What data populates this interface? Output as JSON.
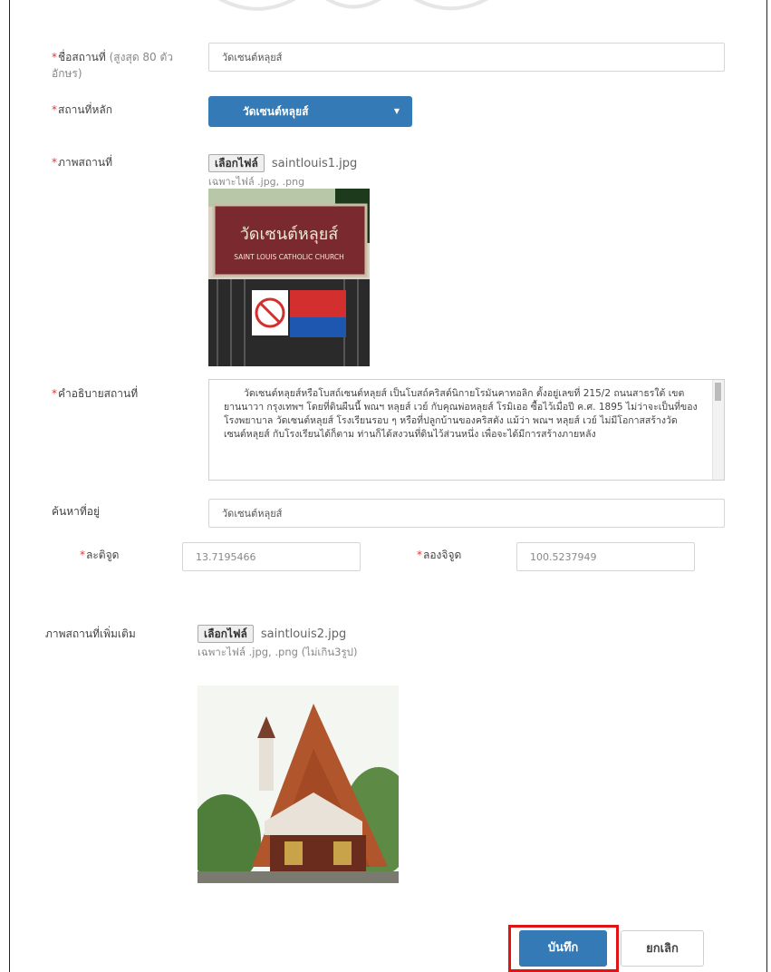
{
  "form": {
    "place_name": {
      "label": "ชื่อสถานที่",
      "note": "(สูงสุด 80 ตัวอักษร)",
      "value": "วัดเซนต์หลุยส์"
    },
    "main_place": {
      "label": "สถานที่หลัก",
      "selected": "วัดเซนต์หลุยส์"
    },
    "place_image": {
      "label": "ภาพสถานที่",
      "button": "เลือกไฟล์",
      "filename": "saintlouis1.jpg",
      "hint": "เฉพาะไฟล์ .jpg, .png",
      "sign_text": "วัดเซนต์หลุยส์",
      "sign_subtext": "SAINT LOUIS CATHOLIC CHURCH"
    },
    "description": {
      "label": "คำอธิบายสถานที่",
      "text": "วัดเซนต์หลุยส์หรือโบสถ์เซนต์หลุยส์ เป็นโบสถ์คริสต์นิกายโรมันคาทอลิก ตั้งอยู่เลขที่ 215/2 ถนนสาธรใต้ เขตยานนาวา กรุงเทพฯ โดยที่ดินผืนนี้ พณฯ หลุยส์ เวย์ กับคุณพ่อหลุยส์ โรมิเออ ซื้อไว้เมื่อปี ค.ศ. 1895 ไม่ว่าจะเป็นที่ของโรงพยาบาล วัดเซนต์หลุยส์ โรงเรียนรอบ ๆ หรือที่ปลูกบ้านของคริสตัง แม้ว่า พณฯ หลุยส์ เวย์ ไม่มีโอกาสสร้างวัดเซนต์หลุยส์ กับโรงเรียนได้ก็ตาม ท่านก็ได้สงวนที่ดินไว้ส่วนหนึ่ง เพื่อจะได้มีการสร้างภายหลัง"
    },
    "search_location": {
      "label": "ค้นหาที่อยู่",
      "value": "วัดเซนต์หลุยส์"
    },
    "latitude": {
      "label": "ละติจูด",
      "value": "13.7195466"
    },
    "longitude": {
      "label": "ลองจิจูด",
      "value": "100.5237949"
    },
    "extra_images": {
      "label": "ภาพสถานที่เพิ่มเติม",
      "button": "เลือกไฟล์",
      "filename": "saintlouis2.jpg",
      "hint": "เฉพาะไฟล์ .jpg, .png (ไม่เกิน3รูป)"
    },
    "required_mark": "*",
    "save_label": "บันทึก",
    "cancel_label": "ยกเลิก"
  },
  "colors": {
    "primary": "#337ab7",
    "required": "#e53935",
    "highlight": "#e01414"
  }
}
